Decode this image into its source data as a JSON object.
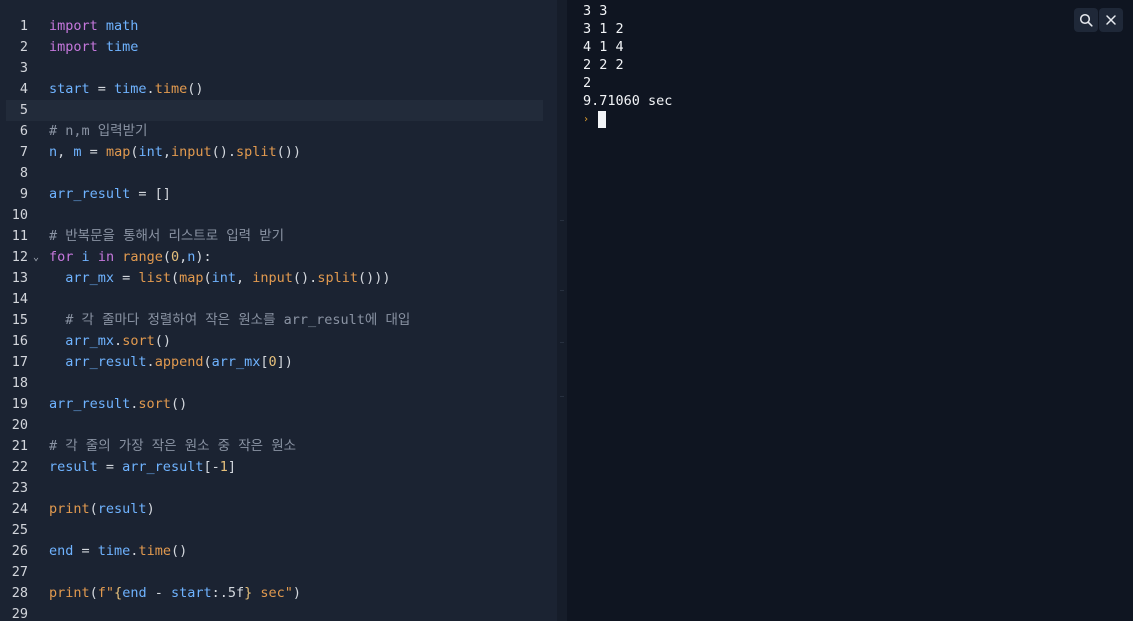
{
  "editor": {
    "active_line": 5,
    "lines": [
      {
        "n": "1",
        "tokens": [
          [
            "kw",
            "import"
          ],
          [
            "op",
            " "
          ],
          [
            "var",
            "math"
          ]
        ]
      },
      {
        "n": "2",
        "tokens": [
          [
            "kw",
            "import"
          ],
          [
            "op",
            " "
          ],
          [
            "var",
            "time"
          ]
        ]
      },
      {
        "n": "3",
        "tokens": []
      },
      {
        "n": "4",
        "tokens": [
          [
            "var",
            "start"
          ],
          [
            "op",
            " = "
          ],
          [
            "var",
            "time"
          ],
          [
            "op",
            "."
          ],
          [
            "fn",
            "time"
          ],
          [
            "op",
            "()"
          ]
        ]
      },
      {
        "n": "5",
        "tokens": []
      },
      {
        "n": "6",
        "tokens": [
          [
            "cmt",
            "# n,m 입력받기"
          ]
        ]
      },
      {
        "n": "7",
        "tokens": [
          [
            "var",
            "n"
          ],
          [
            "op",
            ", "
          ],
          [
            "var",
            "m"
          ],
          [
            "op",
            " = "
          ],
          [
            "fn",
            "map"
          ],
          [
            "op",
            "("
          ],
          [
            "var",
            "int"
          ],
          [
            "op",
            ","
          ],
          [
            "fn",
            "input"
          ],
          [
            "op",
            "()."
          ],
          [
            "fn",
            "split"
          ],
          [
            "op",
            "())"
          ]
        ]
      },
      {
        "n": "8",
        "tokens": []
      },
      {
        "n": "9",
        "tokens": [
          [
            "var",
            "arr_result"
          ],
          [
            "op",
            " = []"
          ]
        ]
      },
      {
        "n": "10",
        "tokens": []
      },
      {
        "n": "11",
        "tokens": [
          [
            "cmt",
            "# 반복문을 통해서 리스트로 입력 받기"
          ]
        ]
      },
      {
        "n": "12",
        "fold": true,
        "tokens": [
          [
            "kw",
            "for"
          ],
          [
            "op",
            " "
          ],
          [
            "var",
            "i"
          ],
          [
            "op",
            " "
          ],
          [
            "kw",
            "in"
          ],
          [
            "op",
            " "
          ],
          [
            "fn",
            "range"
          ],
          [
            "op",
            "("
          ],
          [
            "num",
            "0"
          ],
          [
            "op",
            ","
          ],
          [
            "var",
            "n"
          ],
          [
            "op",
            "):"
          ]
        ]
      },
      {
        "n": "13",
        "tokens": [
          [
            "op",
            "  "
          ],
          [
            "var",
            "arr_mx"
          ],
          [
            "op",
            " = "
          ],
          [
            "fn",
            "list"
          ],
          [
            "op",
            "("
          ],
          [
            "fn",
            "map"
          ],
          [
            "op",
            "("
          ],
          [
            "var",
            "int"
          ],
          [
            "op",
            ", "
          ],
          [
            "fn",
            "input"
          ],
          [
            "op",
            "()."
          ],
          [
            "fn",
            "split"
          ],
          [
            "op",
            "()))"
          ]
        ]
      },
      {
        "n": "14",
        "tokens": []
      },
      {
        "n": "15",
        "tokens": [
          [
            "op",
            "  "
          ],
          [
            "cmt",
            "# 각 줄마다 정렬하여 작은 원소를 arr_result에 대입"
          ]
        ]
      },
      {
        "n": "16",
        "tokens": [
          [
            "op",
            "  "
          ],
          [
            "var",
            "arr_mx"
          ],
          [
            "op",
            "."
          ],
          [
            "fn",
            "sort"
          ],
          [
            "op",
            "()"
          ]
        ]
      },
      {
        "n": "17",
        "tokens": [
          [
            "op",
            "  "
          ],
          [
            "var",
            "arr_result"
          ],
          [
            "op",
            "."
          ],
          [
            "fn",
            "append"
          ],
          [
            "op",
            "("
          ],
          [
            "var",
            "arr_mx"
          ],
          [
            "op",
            "["
          ],
          [
            "num",
            "0"
          ],
          [
            "op",
            "])"
          ]
        ]
      },
      {
        "n": "18",
        "tokens": []
      },
      {
        "n": "19",
        "tokens": [
          [
            "var",
            "arr_result"
          ],
          [
            "op",
            "."
          ],
          [
            "fn",
            "sort"
          ],
          [
            "op",
            "()"
          ]
        ]
      },
      {
        "n": "20",
        "tokens": []
      },
      {
        "n": "21",
        "tokens": [
          [
            "cmt",
            "# 각 줄의 가장 작은 원소 중 작은 원소"
          ]
        ]
      },
      {
        "n": "22",
        "tokens": [
          [
            "var",
            "result"
          ],
          [
            "op",
            " = "
          ],
          [
            "var",
            "arr_result"
          ],
          [
            "op",
            "[-"
          ],
          [
            "num",
            "1"
          ],
          [
            "op",
            "]"
          ]
        ]
      },
      {
        "n": "23",
        "tokens": []
      },
      {
        "n": "24",
        "tokens": [
          [
            "fn",
            "print"
          ],
          [
            "op",
            "("
          ],
          [
            "var",
            "result"
          ],
          [
            "op",
            ")"
          ]
        ]
      },
      {
        "n": "25",
        "tokens": []
      },
      {
        "n": "26",
        "tokens": [
          [
            "var",
            "end"
          ],
          [
            "op",
            " = "
          ],
          [
            "var",
            "time"
          ],
          [
            "op",
            "."
          ],
          [
            "fn",
            "time"
          ],
          [
            "op",
            "()"
          ]
        ]
      },
      {
        "n": "27",
        "tokens": []
      },
      {
        "n": "28",
        "tokens": [
          [
            "fn",
            "print"
          ],
          [
            "op",
            "("
          ],
          [
            "str",
            "f\""
          ],
          [
            "ob",
            "{"
          ],
          [
            "fv",
            "end"
          ],
          [
            "op",
            " - "
          ],
          [
            "fv",
            "start"
          ],
          [
            "op",
            ":.5f"
          ],
          [
            "ob",
            "}"
          ],
          [
            "str",
            " sec\""
          ],
          [
            "op",
            ")"
          ]
        ]
      },
      {
        "n": "29",
        "tokens": []
      }
    ]
  },
  "console": {
    "output_lines": [
      "3 3",
      "3 1 2",
      "4 1 4",
      "2 2 2",
      "2",
      "9.71060 sec"
    ],
    "prompt_symbol": "›"
  },
  "toolbar": {
    "search_icon": "search-icon",
    "close_icon": "close-icon"
  },
  "colors": {
    "editor_bg": "#1b2332",
    "console_bg": "#0f1521",
    "keyword": "#c678dd",
    "variable": "#6fb3ff",
    "function": "#e29a4f",
    "number": "#e6c07b",
    "comment": "#8a93a3",
    "prompt": "#e0a030"
  }
}
